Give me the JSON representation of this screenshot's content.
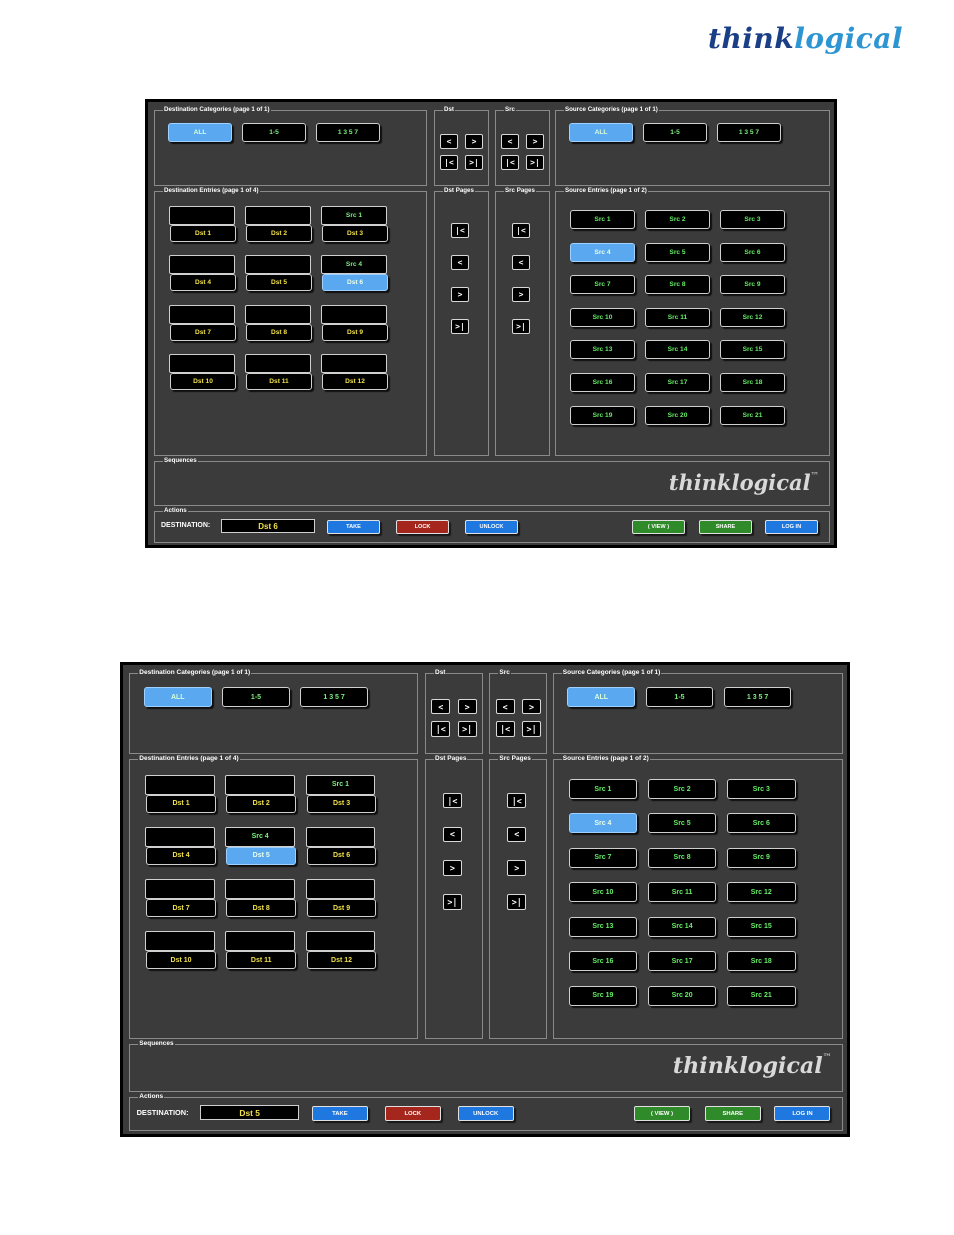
{
  "header": {
    "brand_part1": "think",
    "brand_part2": "logical"
  },
  "colors": {
    "brand_dark": "#1a3f86",
    "brand_light": "#2e95d3",
    "selected": "#5aa8f0",
    "source_text": "#66ee66",
    "destination_text": "#f2e24a",
    "take": "#1f78e0",
    "lock": "#a5261c",
    "unlock": "#1f78e0",
    "view": "#2f8a2a",
    "share": "#2f8a2a",
    "login": "#1f78e0"
  },
  "screens": [
    {
      "panels": {
        "dest_categories": "Destination Categories (page 1 of 1)",
        "dst": "Dst",
        "src": "Src",
        "source_categories": "Source Categories (page 1 of 1)",
        "dest_entries": "Destination Entries (page 1 of 4)",
        "dst_pages": "Dst Pages",
        "src_pages": "Src Pages",
        "source_entries": "Source Entries (page 1 of 2)",
        "sequences": "Sequences",
        "actions": "Actions"
      },
      "dest_categories": [
        "ALL",
        "1-5",
        "1 3 5 7"
      ],
      "source_categories": [
        "ALL",
        "1-5",
        "1 3 5 7"
      ],
      "nav": {
        "prev": "<",
        "next": ">",
        "first": "|<",
        "last": ">|"
      },
      "destinations": [
        {
          "label": "Dst 1",
          "source": ""
        },
        {
          "label": "Dst 2",
          "source": ""
        },
        {
          "label": "Dst 3",
          "source": "Src 1"
        },
        {
          "label": "Dst 4",
          "source": ""
        },
        {
          "label": "Dst 5",
          "source": ""
        },
        {
          "label": "Dst 6",
          "source": "Src 4"
        },
        {
          "label": "Dst 7",
          "source": ""
        },
        {
          "label": "Dst 8",
          "source": ""
        },
        {
          "label": "Dst 9",
          "source": ""
        },
        {
          "label": "Dst 10",
          "source": ""
        },
        {
          "label": "Dst 11",
          "source": ""
        },
        {
          "label": "Dst 12",
          "source": ""
        }
      ],
      "selected_destination": "Dst 6",
      "sources": [
        "Src 1",
        "Src 2",
        "Src 3",
        "Src 4",
        "Src 5",
        "Src 6",
        "Src 7",
        "Src 8",
        "Src 9",
        "Src 10",
        "Src 11",
        "Src 12",
        "Src 13",
        "Src 14",
        "Src 15",
        "Src 16",
        "Src 17",
        "Src 18",
        "Src 19",
        "Src 20",
        "Src 21"
      ],
      "selected_source": "Src 4",
      "logo": "thinklogical",
      "logo_tm": "™",
      "actions": {
        "destination_label": "DESTINATION:",
        "destination_value": "Dst 6",
        "take": "TAKE",
        "lock": "LOCK",
        "unlock": "UNLOCK",
        "view": "( VIEW )",
        "share": "SHARE",
        "login": "LOG IN"
      }
    },
    {
      "panels": {
        "dest_categories": "Destination Categories (page 1 of 1)",
        "dst": "Dst",
        "src": "Src",
        "source_categories": "Source Categories (page 1 of 1)",
        "dest_entries": "Destination Entries (page 1 of 4)",
        "dst_pages": "Dst Pages",
        "src_pages": "Src Pages",
        "source_entries": "Source Entries (page 1 of 2)",
        "sequences": "Sequences",
        "actions": "Actions"
      },
      "dest_categories": [
        "ALL",
        "1-5",
        "1 3 5 7"
      ],
      "source_categories": [
        "ALL",
        "1-5",
        "1 3 5 7"
      ],
      "nav": {
        "prev": "<",
        "next": ">",
        "first": "|<",
        "last": ">|"
      },
      "destinations": [
        {
          "label": "Dst 1",
          "source": ""
        },
        {
          "label": "Dst 2",
          "source": ""
        },
        {
          "label": "Dst 3",
          "source": "Src 1"
        },
        {
          "label": "Dst 4",
          "source": ""
        },
        {
          "label": "Dst 5",
          "source": "Src 4"
        },
        {
          "label": "Dst 6",
          "source": ""
        },
        {
          "label": "Dst 7",
          "source": ""
        },
        {
          "label": "Dst 8",
          "source": ""
        },
        {
          "label": "Dst 9",
          "source": ""
        },
        {
          "label": "Dst 10",
          "source": ""
        },
        {
          "label": "Dst 11",
          "source": ""
        },
        {
          "label": "Dst 12",
          "source": ""
        }
      ],
      "selected_destination": "Dst 5",
      "sources": [
        "Src 1",
        "Src 2",
        "Src 3",
        "Src 4",
        "Src 5",
        "Src 6",
        "Src 7",
        "Src 8",
        "Src 9",
        "Src 10",
        "Src 11",
        "Src 12",
        "Src 13",
        "Src 14",
        "Src 15",
        "Src 16",
        "Src 17",
        "Src 18",
        "Src 19",
        "Src 20",
        "Src 21"
      ],
      "selected_source": "Src 4",
      "logo": "thinklogical",
      "logo_tm": "™",
      "actions": {
        "destination_label": "DESTINATION:",
        "destination_value": "Dst 5",
        "take": "TAKE",
        "lock": "LOCK",
        "unlock": "UNLOCK",
        "view": "( VIEW )",
        "share": "SHARE",
        "login": "LOG IN"
      }
    }
  ]
}
